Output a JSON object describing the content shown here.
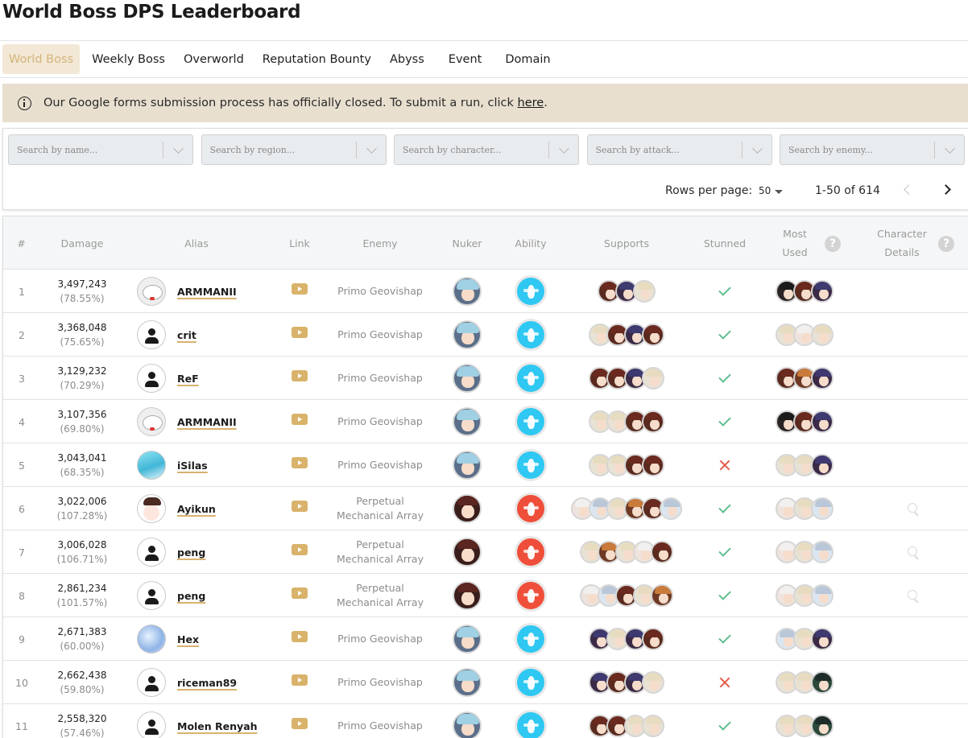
{
  "page": {
    "title": "World Boss DPS Leaderboard"
  },
  "tabs": [
    {
      "label": "World Boss",
      "active": true
    },
    {
      "label": "Weekly Boss"
    },
    {
      "label": "Overworld"
    },
    {
      "label": "Reputation Bounty"
    },
    {
      "label": "Abyss"
    },
    {
      "label": "Event"
    },
    {
      "label": "Domain"
    }
  ],
  "notice": {
    "text": "Our Google forms submission process has officially closed. To submit a run, click ",
    "link": "here",
    "suffix": "."
  },
  "filters": [
    {
      "placeholder": "Search by name..."
    },
    {
      "placeholder": "Search by region..."
    },
    {
      "placeholder": "Search by character..."
    },
    {
      "placeholder": "Search by attack..."
    },
    {
      "placeholder": "Search by enemy..."
    }
  ],
  "pagination": {
    "rows_label": "Rows per page:",
    "rows_value": "50",
    "range": "1-50 of 614"
  },
  "columns": {
    "rank": "#",
    "damage": "Damage",
    "alias": "Alias",
    "link": "Link",
    "enemy": "Enemy",
    "nuker": "Nuker",
    "ability": "Ability",
    "supports": "Supports",
    "stunned": "Stunned",
    "most_used_1": "Most",
    "most_used_2": "Used",
    "details_1": "Character",
    "details_2": "Details",
    "help": "?"
  },
  "rows": [
    {
      "rank": "1",
      "damage": "3,497,243",
      "pct": "(78.55%)",
      "alias": "ARMMANII",
      "avatar": "cat",
      "enemy": "Primo Geovishap",
      "nuker": "eula",
      "ability": "cryo",
      "supports": [
        "c1",
        "c2",
        "c3"
      ],
      "stunned": true,
      "most_used": [
        "c4",
        "c1",
        "c2"
      ],
      "details": false
    },
    {
      "rank": "2",
      "damage": "3,368,048",
      "pct": "(75.65%)",
      "alias": "crit",
      "avatar": "person",
      "enemy": "Primo Geovishap",
      "nuker": "eula",
      "ability": "cryo",
      "supports": [
        "c3",
        "c1",
        "c2",
        "c1"
      ],
      "stunned": true,
      "most_used": [
        "c3",
        "c5",
        "c3"
      ],
      "details": false
    },
    {
      "rank": "3",
      "damage": "3,129,232",
      "pct": "(70.29%)",
      "alias": "ReF",
      "avatar": "person",
      "enemy": "Primo Geovishap",
      "nuker": "eula",
      "ability": "cryo",
      "supports": [
        "c1",
        "c1",
        "c2",
        "c3"
      ],
      "stunned": true,
      "most_used": [
        "c1",
        "c7",
        "c2"
      ],
      "details": false
    },
    {
      "rank": "4",
      "damage": "3,107,356",
      "pct": "(69.80%)",
      "alias": "ARMMANII",
      "avatar": "cat",
      "enemy": "Primo Geovishap",
      "nuker": "eula",
      "ability": "cryo",
      "supports": [
        "c3",
        "c3",
        "c1",
        "c1"
      ],
      "stunned": true,
      "most_used": [
        "c4",
        "c1",
        "c2"
      ],
      "details": false
    },
    {
      "rank": "5",
      "damage": "3,043,041",
      "pct": "(68.35%)",
      "alias": "iSilas",
      "avatar": "blue",
      "enemy": "Primo Geovishap",
      "nuker": "eula",
      "ability": "cryo",
      "supports": [
        "c3",
        "c3",
        "c1",
        "c1"
      ],
      "stunned": false,
      "most_used": [
        "c3",
        "c3",
        "c2"
      ],
      "details": false
    },
    {
      "rank": "6",
      "damage": "3,022,006",
      "pct": "(107.28%)",
      "alias": "Ayikun",
      "avatar": "girl",
      "enemy_1": "Perpetual",
      "enemy_2": "Mechanical Array",
      "nuker": "hutao",
      "ability": "pyro",
      "supports": [
        "c5",
        "c8",
        "c3",
        "c7",
        "c1",
        "c8"
      ],
      "stunned": true,
      "most_used": [
        "c5",
        "c3",
        "c8"
      ],
      "details": true
    },
    {
      "rank": "7",
      "damage": "3,006,028",
      "pct": "(106.71%)",
      "alias": "peng",
      "avatar": "person",
      "enemy_1": "Perpetual",
      "enemy_2": "Mechanical Array",
      "nuker": "hutao",
      "ability": "pyro",
      "supports": [
        "c3",
        "c7",
        "c3",
        "c5",
        "c1"
      ],
      "stunned": true,
      "most_used": [
        "c5",
        "c3",
        "c8"
      ],
      "details": true
    },
    {
      "rank": "8",
      "damage": "2,861,234",
      "pct": "(101.57%)",
      "alias": "peng",
      "avatar": "person",
      "enemy_1": "Perpetual",
      "enemy_2": "Mechanical Array",
      "nuker": "hutao",
      "ability": "pyro",
      "supports": [
        "c5",
        "c8",
        "c1",
        "c3",
        "c7"
      ],
      "stunned": true,
      "most_used": [
        "c5",
        "c3",
        "c8"
      ],
      "details": true
    },
    {
      "rank": "9",
      "damage": "2,671,383",
      "pct": "(60.00%)",
      "alias": "Hex",
      "avatar": "snow",
      "enemy": "Primo Geovishap",
      "nuker": "eula",
      "ability": "cryo",
      "supports": [
        "c2",
        "c3",
        "c2",
        "c1"
      ],
      "stunned": true,
      "most_used": [
        "c8",
        "c3",
        "c2"
      ],
      "details": false
    },
    {
      "rank": "10",
      "damage": "2,662,438",
      "pct": "(59.80%)",
      "alias": "riceman89",
      "avatar": "person",
      "enemy": "Primo Geovishap",
      "nuker": "eula",
      "ability": "cryo",
      "supports": [
        "c2",
        "c1",
        "c2",
        "c3"
      ],
      "stunned": false,
      "most_used": [
        "c3",
        "c3",
        "c6"
      ],
      "details": false
    },
    {
      "rank": "11",
      "damage": "2,558,320",
      "pct": "(57.46%)",
      "alias": "Molen Renyah",
      "avatar": "person",
      "enemy": "Primo Geovishap",
      "nuker": "eula",
      "ability": "cryo",
      "supports": [
        "c1",
        "c1",
        "c3",
        "c3"
      ],
      "stunned": true,
      "most_used": [
        "c3",
        "c3",
        "c6"
      ],
      "details": false
    }
  ]
}
